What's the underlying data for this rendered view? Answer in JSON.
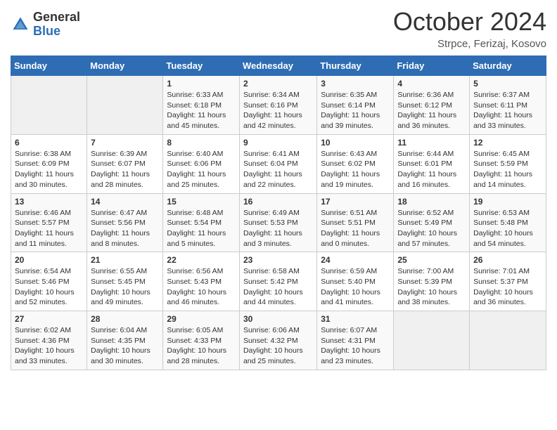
{
  "header": {
    "logo": {
      "general": "General",
      "blue": "Blue"
    },
    "title": "October 2024",
    "location": "Strpce, Ferizaj, Kosovo"
  },
  "weekdays": [
    "Sunday",
    "Monday",
    "Tuesday",
    "Wednesday",
    "Thursday",
    "Friday",
    "Saturday"
  ],
  "weeks": [
    [
      {
        "day": "",
        "sunrise": "",
        "sunset": "",
        "daylight": ""
      },
      {
        "day": "",
        "sunrise": "",
        "sunset": "",
        "daylight": ""
      },
      {
        "day": "1",
        "sunrise": "Sunrise: 6:33 AM",
        "sunset": "Sunset: 6:18 PM",
        "daylight": "Daylight: 11 hours and 45 minutes."
      },
      {
        "day": "2",
        "sunrise": "Sunrise: 6:34 AM",
        "sunset": "Sunset: 6:16 PM",
        "daylight": "Daylight: 11 hours and 42 minutes."
      },
      {
        "day": "3",
        "sunrise": "Sunrise: 6:35 AM",
        "sunset": "Sunset: 6:14 PM",
        "daylight": "Daylight: 11 hours and 39 minutes."
      },
      {
        "day": "4",
        "sunrise": "Sunrise: 6:36 AM",
        "sunset": "Sunset: 6:12 PM",
        "daylight": "Daylight: 11 hours and 36 minutes."
      },
      {
        "day": "5",
        "sunrise": "Sunrise: 6:37 AM",
        "sunset": "Sunset: 6:11 PM",
        "daylight": "Daylight: 11 hours and 33 minutes."
      }
    ],
    [
      {
        "day": "6",
        "sunrise": "Sunrise: 6:38 AM",
        "sunset": "Sunset: 6:09 PM",
        "daylight": "Daylight: 11 hours and 30 minutes."
      },
      {
        "day": "7",
        "sunrise": "Sunrise: 6:39 AM",
        "sunset": "Sunset: 6:07 PM",
        "daylight": "Daylight: 11 hours and 28 minutes."
      },
      {
        "day": "8",
        "sunrise": "Sunrise: 6:40 AM",
        "sunset": "Sunset: 6:06 PM",
        "daylight": "Daylight: 11 hours and 25 minutes."
      },
      {
        "day": "9",
        "sunrise": "Sunrise: 6:41 AM",
        "sunset": "Sunset: 6:04 PM",
        "daylight": "Daylight: 11 hours and 22 minutes."
      },
      {
        "day": "10",
        "sunrise": "Sunrise: 6:43 AM",
        "sunset": "Sunset: 6:02 PM",
        "daylight": "Daylight: 11 hours and 19 minutes."
      },
      {
        "day": "11",
        "sunrise": "Sunrise: 6:44 AM",
        "sunset": "Sunset: 6:01 PM",
        "daylight": "Daylight: 11 hours and 16 minutes."
      },
      {
        "day": "12",
        "sunrise": "Sunrise: 6:45 AM",
        "sunset": "Sunset: 5:59 PM",
        "daylight": "Daylight: 11 hours and 14 minutes."
      }
    ],
    [
      {
        "day": "13",
        "sunrise": "Sunrise: 6:46 AM",
        "sunset": "Sunset: 5:57 PM",
        "daylight": "Daylight: 11 hours and 11 minutes."
      },
      {
        "day": "14",
        "sunrise": "Sunrise: 6:47 AM",
        "sunset": "Sunset: 5:56 PM",
        "daylight": "Daylight: 11 hours and 8 minutes."
      },
      {
        "day": "15",
        "sunrise": "Sunrise: 6:48 AM",
        "sunset": "Sunset: 5:54 PM",
        "daylight": "Daylight: 11 hours and 5 minutes."
      },
      {
        "day": "16",
        "sunrise": "Sunrise: 6:49 AM",
        "sunset": "Sunset: 5:53 PM",
        "daylight": "Daylight: 11 hours and 3 minutes."
      },
      {
        "day": "17",
        "sunrise": "Sunrise: 6:51 AM",
        "sunset": "Sunset: 5:51 PM",
        "daylight": "Daylight: 11 hours and 0 minutes."
      },
      {
        "day": "18",
        "sunrise": "Sunrise: 6:52 AM",
        "sunset": "Sunset: 5:49 PM",
        "daylight": "Daylight: 10 hours and 57 minutes."
      },
      {
        "day": "19",
        "sunrise": "Sunrise: 6:53 AM",
        "sunset": "Sunset: 5:48 PM",
        "daylight": "Daylight: 10 hours and 54 minutes."
      }
    ],
    [
      {
        "day": "20",
        "sunrise": "Sunrise: 6:54 AM",
        "sunset": "Sunset: 5:46 PM",
        "daylight": "Daylight: 10 hours and 52 minutes."
      },
      {
        "day": "21",
        "sunrise": "Sunrise: 6:55 AM",
        "sunset": "Sunset: 5:45 PM",
        "daylight": "Daylight: 10 hours and 49 minutes."
      },
      {
        "day": "22",
        "sunrise": "Sunrise: 6:56 AM",
        "sunset": "Sunset: 5:43 PM",
        "daylight": "Daylight: 10 hours and 46 minutes."
      },
      {
        "day": "23",
        "sunrise": "Sunrise: 6:58 AM",
        "sunset": "Sunset: 5:42 PM",
        "daylight": "Daylight: 10 hours and 44 minutes."
      },
      {
        "day": "24",
        "sunrise": "Sunrise: 6:59 AM",
        "sunset": "Sunset: 5:40 PM",
        "daylight": "Daylight: 10 hours and 41 minutes."
      },
      {
        "day": "25",
        "sunrise": "Sunrise: 7:00 AM",
        "sunset": "Sunset: 5:39 PM",
        "daylight": "Daylight: 10 hours and 38 minutes."
      },
      {
        "day": "26",
        "sunrise": "Sunrise: 7:01 AM",
        "sunset": "Sunset: 5:37 PM",
        "daylight": "Daylight: 10 hours and 36 minutes."
      }
    ],
    [
      {
        "day": "27",
        "sunrise": "Sunrise: 6:02 AM",
        "sunset": "Sunset: 4:36 PM",
        "daylight": "Daylight: 10 hours and 33 minutes."
      },
      {
        "day": "28",
        "sunrise": "Sunrise: 6:04 AM",
        "sunset": "Sunset: 4:35 PM",
        "daylight": "Daylight: 10 hours and 30 minutes."
      },
      {
        "day": "29",
        "sunrise": "Sunrise: 6:05 AM",
        "sunset": "Sunset: 4:33 PM",
        "daylight": "Daylight: 10 hours and 28 minutes."
      },
      {
        "day": "30",
        "sunrise": "Sunrise: 6:06 AM",
        "sunset": "Sunset: 4:32 PM",
        "daylight": "Daylight: 10 hours and 25 minutes."
      },
      {
        "day": "31",
        "sunrise": "Sunrise: 6:07 AM",
        "sunset": "Sunset: 4:31 PM",
        "daylight": "Daylight: 10 hours and 23 minutes."
      },
      {
        "day": "",
        "sunrise": "",
        "sunset": "",
        "daylight": ""
      },
      {
        "day": "",
        "sunrise": "",
        "sunset": "",
        "daylight": ""
      }
    ]
  ]
}
